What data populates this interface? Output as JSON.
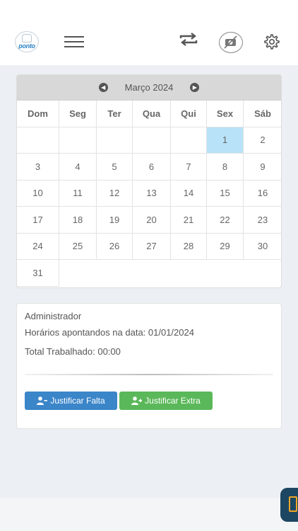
{
  "header": {
    "logo_text": "ponto",
    "icons": [
      "menu-icon",
      "sync-icon",
      "camera-off-icon",
      "gear-icon"
    ]
  },
  "calendar": {
    "month_label": "Março 2024",
    "weekdays": [
      "Dom",
      "Seg",
      "Ter",
      "Qua",
      "Qui",
      "Sex",
      "Sáb"
    ],
    "weeks": [
      [
        "",
        "",
        "",
        "",
        "",
        "1",
        "2"
      ],
      [
        "3",
        "4",
        "5",
        "6",
        "7",
        "8",
        "9"
      ],
      [
        "10",
        "11",
        "12",
        "13",
        "14",
        "15",
        "16"
      ],
      [
        "17",
        "18",
        "19",
        "20",
        "21",
        "22",
        "23"
      ],
      [
        "24",
        "25",
        "26",
        "27",
        "28",
        "29",
        "30"
      ],
      [
        "31"
      ]
    ],
    "selected_day": "1",
    "selected_color": "#b8e2f8"
  },
  "info": {
    "user": "Administrador",
    "schedule_line": "Horários apontandos na data: 01/01/2024",
    "total_line": "Total Trabalhado: 00:00"
  },
  "actions": {
    "justify_absence": "Justificar Falta",
    "justify_extra": "Justificar Extra",
    "absence_color": "#3b85c9",
    "extra_color": "#5bb85a"
  }
}
